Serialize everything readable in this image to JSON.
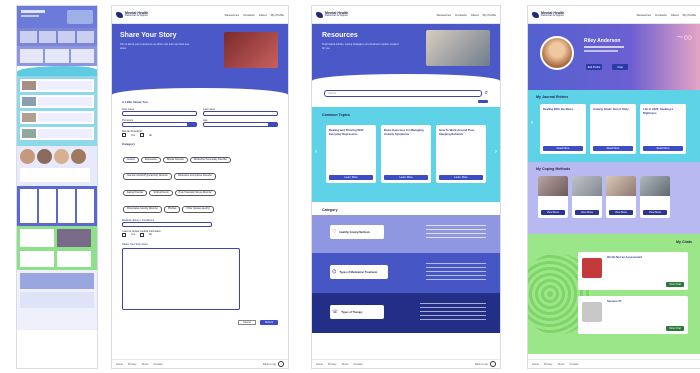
{
  "brand": {
    "name": "Mental Health",
    "tagline": "Resources & Support"
  },
  "nav": {
    "items": [
      "Resources",
      "Contacts",
      "About",
      "My Profile"
    ]
  },
  "footer": {
    "links": [
      "Home",
      "Privacy",
      "Terms",
      "Contact"
    ],
    "up_label": "Back to top"
  },
  "share": {
    "hero_title": "Share Your Story",
    "hero_text": "Tell us about your experience so others can learn and feel less alone.",
    "section_about": "A Little About You",
    "first_name": "First name",
    "last_name": "Last name",
    "pronouns": "Pronouns",
    "age": "Age",
    "mental_disorders": "Mental disorders?",
    "yes": "Yes",
    "no": "No",
    "category_label": "Category",
    "categories": [
      "Anxiety",
      "Depression",
      "Bipolar Disorder",
      "Borderline Personality Disorder",
      "Attention-Deficit/Hyperactivity Disorder",
      "Obsessive-Compulsive Disorder",
      "Eating Disorder",
      "Schizophrenia",
      "Post-Traumatic Stress Disorder",
      "Dissociative Identity Disorder",
      "Phobias",
      "Other (please specify)"
    ],
    "medical_label": "Medical History / Conditions",
    "info_question": "I want to include medical information",
    "story_label": "Share Your Story Here",
    "cancel": "Cancel",
    "submit": "Submit"
  },
  "resources": {
    "hero_title": "Resources",
    "hero_text": "Find helpful articles, coping strategies, and treatment options curated for you.",
    "search_placeholder": "Search",
    "common_title": "Common Topics",
    "topics": [
      {
        "title": "Dealing and Thriving With Everyday Depression",
        "button": "Learn More"
      },
      {
        "title": "Basic Exercises for Managing Anxiety Symptoms",
        "button": "Learn More"
      },
      {
        "title": "How To Work Around Poor Sleeping Behavior",
        "button": "Learn More"
      }
    ],
    "category_title": "Category",
    "categories": [
      "Healthy Coping Methods",
      "Types of Medication Treatment",
      "Types of Therapy"
    ]
  },
  "profile": {
    "name": "Riley Anderson",
    "journal_title": "My Journal Entries",
    "entries": [
      {
        "title": "Dealing With the Blues",
        "button": "Read More"
      },
      {
        "title": "Anxiety Scale: Out of Sixty",
        "button": "Read More"
      },
      {
        "title": "Life in 2023: Seeking a Rightness",
        "button": "Read More"
      }
    ],
    "coping_title": "My Coping Methods",
    "coping_button": "View More",
    "chats_title": "My Chats",
    "chats": [
      {
        "title": "Oh No Not an Assessment",
        "button": "View Chat"
      },
      {
        "title": "Session #7",
        "button": "View Chat"
      }
    ],
    "edit_button": "Edit Profile",
    "chat_button": "Chat"
  },
  "colors": {
    "primary": "#4a58c8",
    "dark": "#1d2b7a",
    "teal": "#5ed3e8",
    "green": "#9ce68a",
    "lavender": "#b7b9f0"
  }
}
